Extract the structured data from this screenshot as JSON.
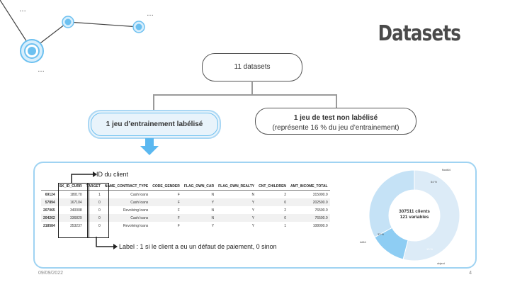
{
  "slide": {
    "title": "Datasets",
    "date": "09/09/2022",
    "page_number": "4"
  },
  "decor": {
    "ellipsis_1": "…",
    "ellipsis_2": "…",
    "ellipsis_3": "…"
  },
  "tree": {
    "root": "11 datasets",
    "train": "1 jeu d’entrainement labélisé",
    "test_line1": "1 jeu de test non labélisé",
    "test_line2": "(représente 16  % du jeu d’entrainement)"
  },
  "table": {
    "columns": [
      "",
      "SK_ID_CURR",
      "TARGET",
      "NAME_CONTRACT_TYPE",
      "CODE_GENDER",
      "FLAG_OWN_CAR",
      "FLAG_OWN_REALTY",
      "CNT_CHILDREN",
      "AMT_INCOME_TOTAL"
    ],
    "rows": [
      [
        "69124",
        "180170",
        "1",
        "Cash loans",
        "F",
        "N",
        "N",
        "2",
        "315000.0"
      ],
      [
        "57894",
        "167104",
        "0",
        "Cash loans",
        "F",
        "Y",
        "Y",
        "0",
        "202500.0"
      ],
      [
        "207065",
        "340008",
        "0",
        "Revolving loans",
        "F",
        "N",
        "Y",
        "2",
        "76500.0"
      ],
      [
        "204262",
        "336829",
        "0",
        "Cash loans",
        "F",
        "N",
        "Y",
        "0",
        "76500.0"
      ],
      [
        "218584",
        "353237",
        "0",
        "Revolving loans",
        "F",
        "Y",
        "Y",
        "1",
        "108000.0"
      ]
    ]
  },
  "annotations": {
    "id_client": "ID du client",
    "label": "Label : 1 si le client a eu un défaut de paiement, 0 sinon"
  },
  "donut": {
    "center_line1": "307511 clients",
    "center_line2": "121 variables",
    "slices": [
      {
        "name": "float64",
        "percent": "54 %",
        "value": 54,
        "color": "#dcebf7"
      },
      {
        "name": "object",
        "percent": "13 %",
        "value": 13,
        "color": "#8ecdf3"
      },
      {
        "name": "int64",
        "percent": "33 %",
        "value": 33,
        "color": "#c5e2f6"
      }
    ]
  },
  "colors": {
    "accent": "#6cc0f0",
    "panel_border": "#9fd3f2",
    "arrow": "#5bb8f0"
  }
}
